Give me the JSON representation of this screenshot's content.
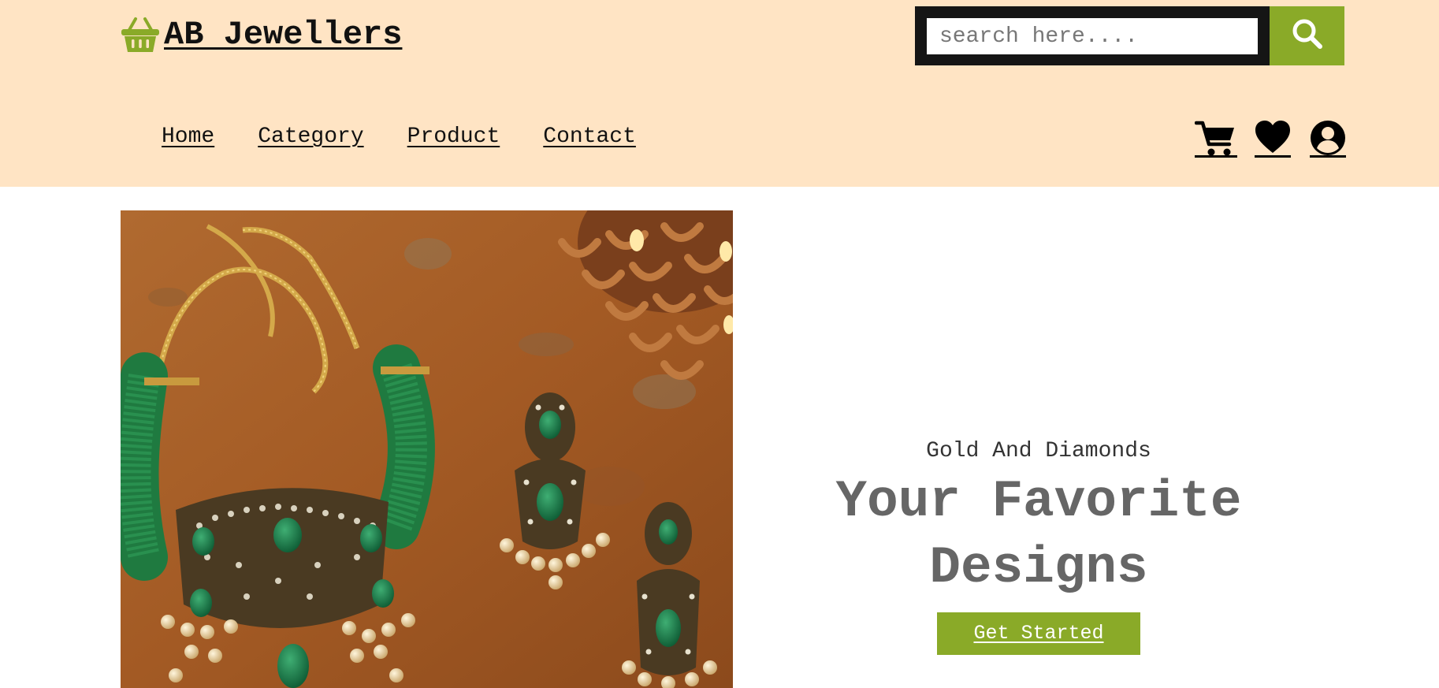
{
  "brand": {
    "name": "AB Jewellers",
    "logo_icon": "basket-icon",
    "accent_color": "#8aaa28"
  },
  "search": {
    "placeholder": "search here....",
    "button_icon": "search-icon"
  },
  "nav": {
    "items": [
      {
        "label": "Home"
      },
      {
        "label": "Category"
      },
      {
        "label": "Product"
      },
      {
        "label": "Contact"
      }
    ]
  },
  "header_icons": [
    "cart-icon",
    "heart-icon",
    "user-icon"
  ],
  "colors": {
    "header_bg": "#ffe4c4",
    "accent": "#8aaa28",
    "headline": "#666666"
  },
  "hero": {
    "image_alt": "Emerald necklace and earrings set",
    "subtitle": "Gold And Diamonds",
    "headline": "Your Favorite Designs",
    "cta_label": "Get Started"
  }
}
